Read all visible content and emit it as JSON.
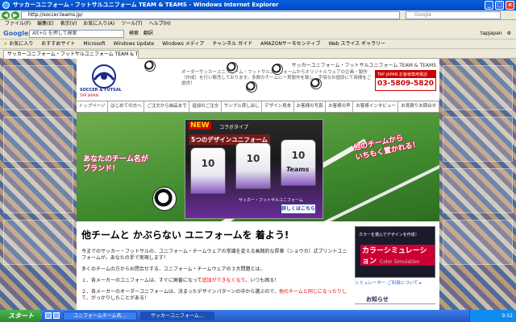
{
  "window": {
    "title": "サッカーユニフォーム・フットサルユニフォーム TEAM & TEAMS - Windows Internet Explorer"
  },
  "address": {
    "url": "http://soccer.teams.jp/",
    "search_placeholder": "Google"
  },
  "menu": [
    "ファイル(F)",
    "編集(E)",
    "表示(V)",
    "お気に入り(A)",
    "ツール(T)",
    "ヘルプ(H)"
  ],
  "google_toolbar": {
    "logo": "Google",
    "search_placeholder": "Alt+G を押して検索",
    "buttons": [
      "検索",
      "翻訳"
    ],
    "user": "tapjapan"
  },
  "favorites": {
    "label": "お気に入り",
    "items": [
      "おすすめサイト",
      "Microsoft",
      "Windows Update",
      "Windows メディア",
      "チャンネル ガイド",
      "AMAZONサーモセンティブ",
      "Web スライス ギャラリー"
    ]
  },
  "tab": {
    "title": "サッカーユニフォーム・フットサルユニフォーム TEAM & TE..."
  },
  "site": {
    "name": "サッカーユニフォーム・フットサルユニフォーム TEAM & TEAMS",
    "logo_text": "SOCCER & FUTSAL",
    "logo_sub": "TAP JAPAN",
    "description": "オーダーサッカーユニフォーム・フットサルユニフォームからオリジナルウェアの企画・製作（作成）を行い販売しております。多数のチームに一貫製作を致し、手頃なお値段にて時間をご提供！",
    "phone_label": "TAP JAPAN お客様専用電話",
    "phone": "03-5809-5820"
  },
  "nav": [
    "トップページ",
    "はじめての方へ",
    "ご注文から納品まで",
    "追加のご注文",
    "サンプル貸し出し",
    "デザイン見本",
    "お客様の写真",
    "お客様の声",
    "お客様インタビュー",
    "お見積りお問合せ"
  ],
  "hero": {
    "caption_left": "あなたのチーム名が\nブランド！",
    "caption_right": "他のチームから\nいちもく置かれる！",
    "ad_badge": "NEW",
    "ad_sub": "コラボタイプ",
    "ad_title": "5つのデザインユニフォーム",
    "shirt_numbers": [
      "10",
      "10",
      "10"
    ],
    "shirt_name": "Teams",
    "ad_caption": "サッカー・フットサルユニフォーム",
    "detail_button": "詳しくはこちら"
  },
  "content": {
    "headline": "他チームと かぶらない ユニフォームを 着よう!",
    "intro": "今までのサッカー・フットサルの、ユニフォーム・チームウェアの常識を変える画期的な昇華（ショウカ）式プリントユニフォームが、あなたの手で実現します！",
    "lead": "多くのチームの方からお問合せする、ユニフォーム・チームウェアの３大問題とは。",
    "item1_text": "１．各メーカーのユニフォームは、すぐに廃番になって",
    "item1_red": "追加ができなくなり",
    "item1_end": "、いつも困る！",
    "item2_text": "２．各メーカーのオーダーユニフォームは、決まったデザインパターンの中から選ぶので、",
    "item2_red": "他のチームと同じになったりして",
    "item2_end": "、がっかりしたことがある！"
  },
  "simulation": {
    "line1": "カラーを選んでデザインを作成！",
    "title": "カラーシミュレーション",
    "sub": "Color Simulation",
    "link": "シミュレーター ご利用について ▸"
  },
  "news": {
    "title": "お知らせ"
  },
  "taskbar": {
    "start": "スタート",
    "tasks": [
      "ユニフォームチーム名...",
      "サッカーユニフォーム..."
    ],
    "time": "9:52"
  }
}
